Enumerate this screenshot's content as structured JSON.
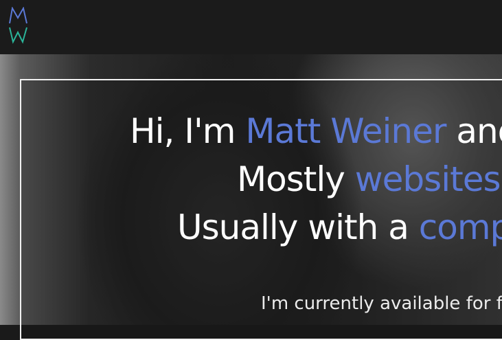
{
  "header": {
    "logo_top": "M",
    "logo_bottom": "W"
  },
  "hero": {
    "line1": {
      "prefix": "Hi, I'm ",
      "name": "Matt Weiner",
      "suffix": " and"
    },
    "line2": {
      "prefix": "Mostly ",
      "accent": "websites"
    },
    "line3": {
      "prefix": "Usually with a ",
      "accent": "comp"
    },
    "availability": "I'm currently available for fre"
  },
  "colors": {
    "accent": "#5b79d6",
    "logo_top": "#5b79d6",
    "logo_bottom": "#2bb59a",
    "header_bg": "#1b1b1b"
  }
}
